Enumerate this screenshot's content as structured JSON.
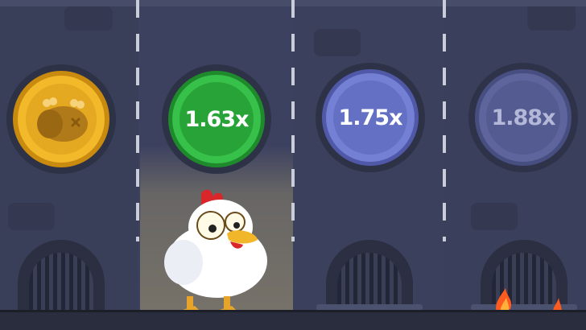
{
  "lanes": [
    {
      "state": "collected",
      "icon": "cooked-chicken-icon"
    },
    {
      "state": "current",
      "multiplier": "1.63x"
    },
    {
      "state": "next",
      "multiplier": "1.75x"
    },
    {
      "state": "locked",
      "multiplier": "1.88x"
    }
  ],
  "colors": {
    "background": "#3b4059",
    "gold_coin": "#e5a821",
    "green_coin": "#2aa53a",
    "blue_coin": "#6a75c8",
    "locked_coin": "#5a6193",
    "fire": "#ff5a1f"
  }
}
